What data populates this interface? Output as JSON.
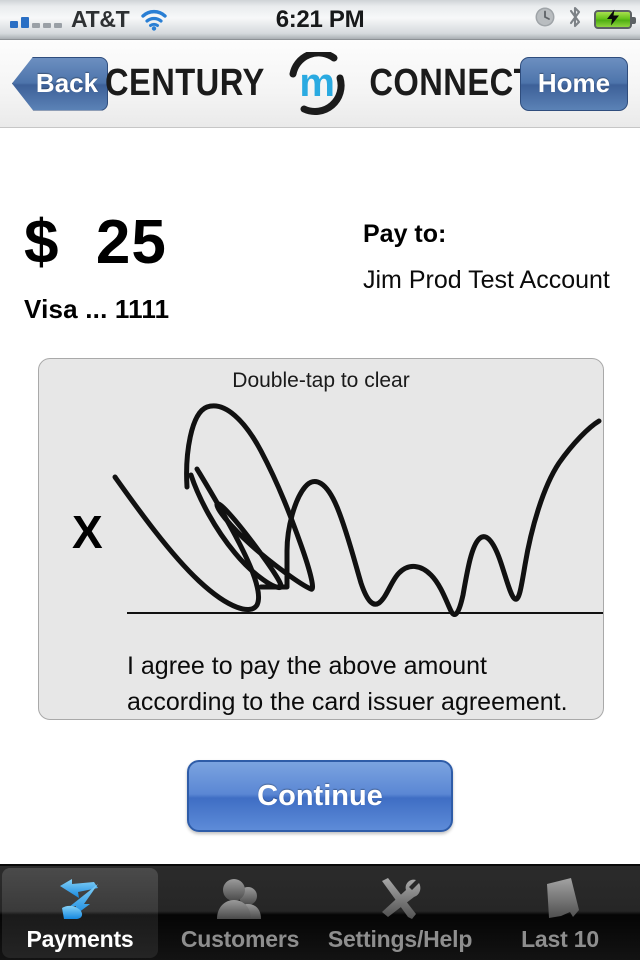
{
  "status_bar": {
    "carrier": "AT&T",
    "time": "6:21 PM",
    "signal_bars_filled": 2,
    "signal_bars_total": 5,
    "icons": [
      "signal-bars-icon",
      "wifi-icon",
      "alarm-clock-icon",
      "bluetooth-icon",
      "battery-charging-icon"
    ]
  },
  "header": {
    "back_label": "Back",
    "home_label": "Home",
    "logo_word_1": "CENTURY",
    "logo_mark_letter": "m",
    "logo_word_2": "CONNECT",
    "logo_accent_color": "#2aaae1"
  },
  "payment": {
    "amount": "$  25",
    "card": "Visa ... 1111",
    "pay_to_label": "Pay to:",
    "pay_to_name": "Jim Prod Test Account"
  },
  "signature": {
    "hint": "Double-tap to clear",
    "x_marker": "X",
    "agreement": "I agree to pay the above amount according to the  card issuer agreement.",
    "pad_background": "#e7e7e7"
  },
  "actions": {
    "continue_label": "Continue",
    "continue_color": "#4d7bcc"
  },
  "tabbar": {
    "items": [
      {
        "label": "Payments",
        "icon": "payments-hand-arrow-icon",
        "active": true
      },
      {
        "label": "Customers",
        "icon": "people-icon",
        "active": false
      },
      {
        "label": "Settings/Help",
        "icon": "wrench-screwdriver-icon",
        "active": false
      },
      {
        "label": "Last 10",
        "icon": "receipt-icon",
        "active": false
      }
    ],
    "active_text_color": "#ffffff",
    "inactive_text_color": "#8e8e8e"
  }
}
